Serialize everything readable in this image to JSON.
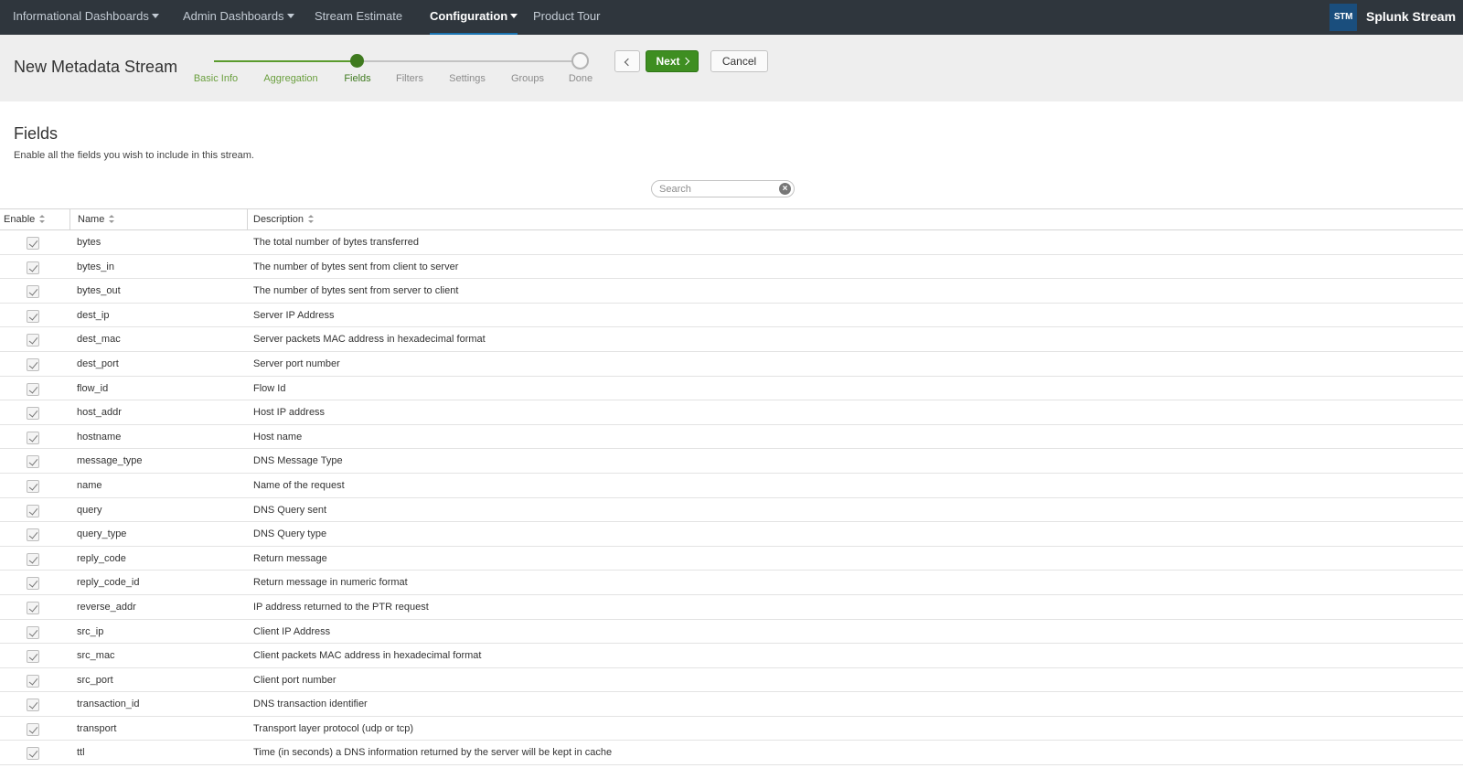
{
  "nav": {
    "items": [
      {
        "label": "Informational Dashboards",
        "dropdown": true,
        "active": false
      },
      {
        "label": "Admin Dashboards",
        "dropdown": true,
        "active": false
      },
      {
        "label": "Stream Estimate",
        "dropdown": false,
        "active": false
      },
      {
        "label": "Configuration",
        "dropdown": true,
        "active": true
      },
      {
        "label": "Product Tour",
        "dropdown": false,
        "active": false
      }
    ],
    "app_badge": "STM",
    "app_title": "Splunk Stream"
  },
  "wizard": {
    "title": "New Metadata Stream",
    "steps": [
      {
        "label": "Basic Info",
        "state": "complete"
      },
      {
        "label": "Aggregation",
        "state": "complete"
      },
      {
        "label": "Fields",
        "state": "current"
      },
      {
        "label": "Filters",
        "state": "pending"
      },
      {
        "label": "Settings",
        "state": "pending"
      },
      {
        "label": "Groups",
        "state": "pending"
      },
      {
        "label": "Done",
        "state": "pending"
      }
    ],
    "prev_icon": "chevron-left-icon",
    "next_label": "Next",
    "cancel_label": "Cancel"
  },
  "section": {
    "title": "Fields",
    "description": "Enable all the fields you wish to include in this stream."
  },
  "search": {
    "placeholder": "Search",
    "value": ""
  },
  "table": {
    "columns": [
      "Enable",
      "Name",
      "Description"
    ],
    "rows": [
      {
        "enabled": true,
        "name": "bytes",
        "description": "The total number of bytes transferred"
      },
      {
        "enabled": true,
        "name": "bytes_in",
        "description": "The number of bytes sent from client to server"
      },
      {
        "enabled": true,
        "name": "bytes_out",
        "description": "The number of bytes sent from server to client"
      },
      {
        "enabled": true,
        "name": "dest_ip",
        "description": "Server IP Address"
      },
      {
        "enabled": true,
        "name": "dest_mac",
        "description": "Server packets MAC address in hexadecimal format"
      },
      {
        "enabled": true,
        "name": "dest_port",
        "description": "Server port number"
      },
      {
        "enabled": true,
        "name": "flow_id",
        "description": "Flow Id"
      },
      {
        "enabled": true,
        "name": "host_addr",
        "description": "Host IP address"
      },
      {
        "enabled": true,
        "name": "hostname",
        "description": "Host name"
      },
      {
        "enabled": true,
        "name": "message_type",
        "description": "DNS Message Type"
      },
      {
        "enabled": true,
        "name": "name",
        "description": "Name of the request"
      },
      {
        "enabled": true,
        "name": "query",
        "description": "DNS Query sent"
      },
      {
        "enabled": true,
        "name": "query_type",
        "description": "DNS Query type"
      },
      {
        "enabled": true,
        "name": "reply_code",
        "description": "Return message"
      },
      {
        "enabled": true,
        "name": "reply_code_id",
        "description": "Return message in numeric format"
      },
      {
        "enabled": true,
        "name": "reverse_addr",
        "description": "IP address returned to the PTR request"
      },
      {
        "enabled": true,
        "name": "src_ip",
        "description": "Client IP Address"
      },
      {
        "enabled": true,
        "name": "src_mac",
        "description": "Client packets MAC address in hexadecimal format"
      },
      {
        "enabled": true,
        "name": "src_port",
        "description": "Client port number"
      },
      {
        "enabled": true,
        "name": "transaction_id",
        "description": "DNS transaction identifier"
      },
      {
        "enabled": true,
        "name": "transport",
        "description": "Transport layer protocol (udp or tcp)"
      },
      {
        "enabled": true,
        "name": "ttl",
        "description": "Time (in seconds) a DNS information returned by the server will be kept in cache"
      }
    ]
  }
}
